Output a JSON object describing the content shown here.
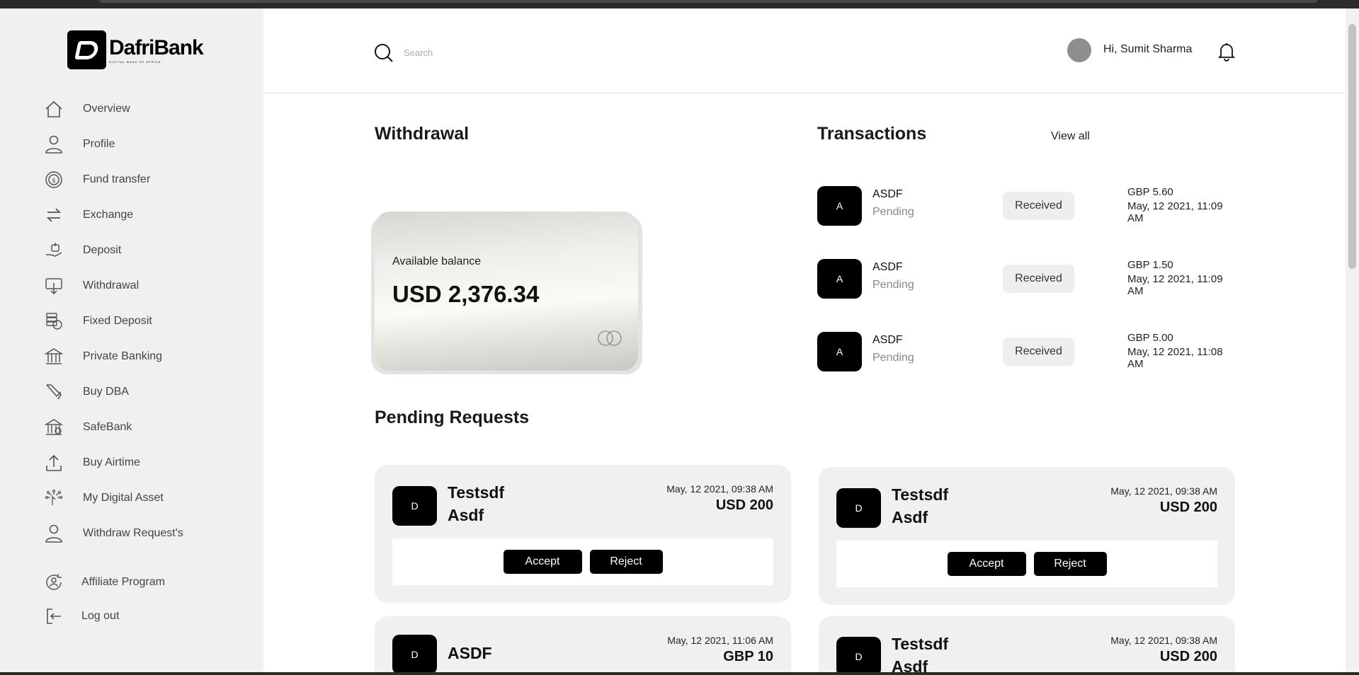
{
  "brand": {
    "name": "DafriBank",
    "tagline": "DIGITAL BANK OF AFRICA"
  },
  "sidebar": {
    "items": [
      {
        "label": "Overview",
        "icon": "home-icon"
      },
      {
        "label": "Profile",
        "icon": "user-icon"
      },
      {
        "label": "Fund transfer",
        "icon": "coin-transfer-icon"
      },
      {
        "label": "Exchange",
        "icon": "exchange-icon"
      },
      {
        "label": "Deposit",
        "icon": "deposit-icon"
      },
      {
        "label": "Withdrawal",
        "icon": "withdrawal-icon"
      },
      {
        "label": "Fixed Deposit",
        "icon": "fixed-deposit-icon"
      },
      {
        "label": "Private Banking",
        "icon": "bank-icon"
      },
      {
        "label": "Buy DBA",
        "icon": "buy-dba-icon"
      },
      {
        "label": "SafeBank",
        "icon": "safebank-icon"
      },
      {
        "label": "Buy Airtime",
        "icon": "upload-icon"
      },
      {
        "label": "My Digital Asset",
        "icon": "digital-asset-icon"
      },
      {
        "label": "Withdraw Request's",
        "icon": "user-icon"
      },
      {
        "label": "Affiliate Program",
        "icon": "affiliate-icon"
      },
      {
        "label": "Log out",
        "icon": "logout-icon"
      }
    ]
  },
  "header": {
    "search_placeholder": "Search",
    "greeting": "Hi, Sumit Sharma"
  },
  "withdrawal": {
    "title": "Withdrawal",
    "balance_label": "Available balance",
    "balance_value": "USD 2,376.34"
  },
  "transactions": {
    "title": "Transactions",
    "view_all": "View all",
    "items": [
      {
        "initial": "A",
        "name": "ASDF",
        "status": "Pending",
        "type": "Received",
        "amount": "GBP 5.60",
        "date": "May, 12 2021, 11:09 AM"
      },
      {
        "initial": "A",
        "name": "ASDF",
        "status": "Pending",
        "type": "Received",
        "amount": "GBP 1.50",
        "date": "May, 12 2021, 11:09 AM"
      },
      {
        "initial": "A",
        "name": "ASDF",
        "status": "Pending",
        "type": "Received",
        "amount": "GBP 5.00",
        "date": "May, 12 2021, 11:08 AM"
      }
    ]
  },
  "pending": {
    "title": "Pending Requests",
    "accept_label": "Accept",
    "reject_label": "Reject",
    "items": [
      {
        "initial": "D",
        "name_line1": "Testsdf",
        "name_line2": "Asdf",
        "date": "May, 12 2021, 09:38 AM",
        "amount": "USD 200"
      },
      {
        "initial": "D",
        "name_line1": "Testsdf",
        "name_line2": "Asdf",
        "date": "May, 12 2021, 09:38 AM",
        "amount": "USD 200"
      },
      {
        "initial": "D",
        "name_line1": "ASDF",
        "name_line2": "",
        "date": "May, 12 2021, 11:06 AM",
        "amount": "GBP 10"
      },
      {
        "initial": "D",
        "name_line1": "Testsdf",
        "name_line2": "Asdf",
        "date": "May, 12 2021, 09:38 AM",
        "amount": "USD 200"
      }
    ]
  },
  "colors": {
    "sidebar_bg": "#f0f0f0",
    "accent": "#000000",
    "card_bg": "#f0f0f0"
  }
}
